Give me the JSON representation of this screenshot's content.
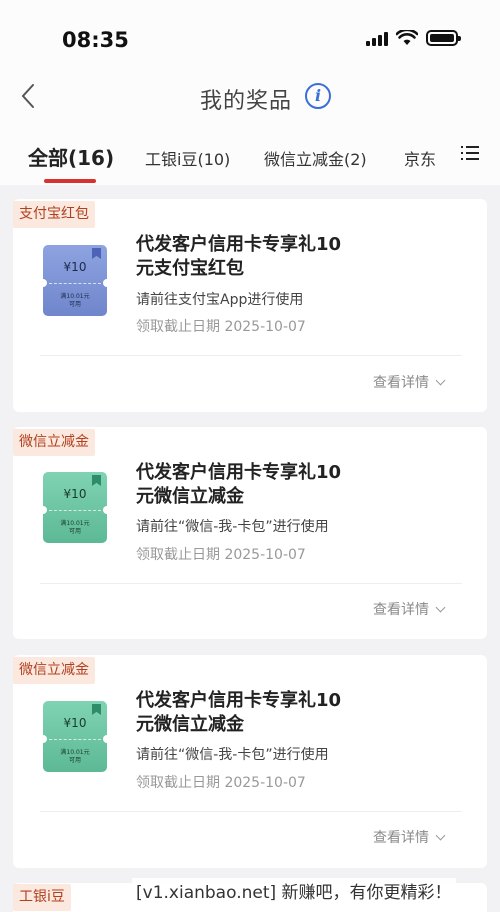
{
  "status_bar": {
    "time": "08:35"
  },
  "header": {
    "title": "我的奖品",
    "info_icon": "info-icon",
    "back_icon": "chevron-left-icon"
  },
  "tabs": [
    {
      "label": "全部(16)",
      "active": true
    },
    {
      "label": "工银i豆(10)",
      "active": false
    },
    {
      "label": "微信立减金(2)",
      "active": false
    },
    {
      "label": "京东",
      "active": false
    }
  ],
  "menu_icon": "list-menu-icon",
  "prizes": [
    {
      "tag": "支付宝红包",
      "ticket": {
        "amount": "¥10",
        "condition_line1": "满10.01元",
        "condition_line2": "可用",
        "color": "#7b90d6"
      },
      "title_line1": "代发客户信用卡专享礼10",
      "title_line2": "元支付宝红包",
      "desc": "请前往支付宝App进行使用",
      "deadline": "领取截止日期 2025-10-07",
      "detail": "查看详情"
    },
    {
      "tag": "微信立减金",
      "ticket": {
        "amount": "¥10",
        "condition_line1": "满10.01元",
        "condition_line2": "可用",
        "color": "#6cc5a3"
      },
      "title_line1": "代发客户信用卡专享礼10",
      "title_line2": "元微信立减金",
      "desc": "请前往“微信-我-卡包”进行使用",
      "deadline": "领取截止日期 2025-10-07",
      "detail": "查看详情"
    },
    {
      "tag": "微信立减金",
      "ticket": {
        "amount": "¥10",
        "condition_line1": "满10.01元",
        "condition_line2": "可用",
        "color": "#6cc5a3"
      },
      "title_line1": "代发客户信用卡专享礼10",
      "title_line2": "元微信立减金",
      "desc": "请前往“微信-我-卡包”进行使用",
      "deadline": "领取截止日期 2025-10-07",
      "detail": "查看详情"
    },
    {
      "tag": "工银i豆"
    }
  ],
  "colors": {
    "accent": "#d9322e",
    "tag_bg": "#fbe8df",
    "tag_text": "#b1401e"
  },
  "watermark": "[v1.xianbao.net] 新赚吧，有你更精彩！"
}
